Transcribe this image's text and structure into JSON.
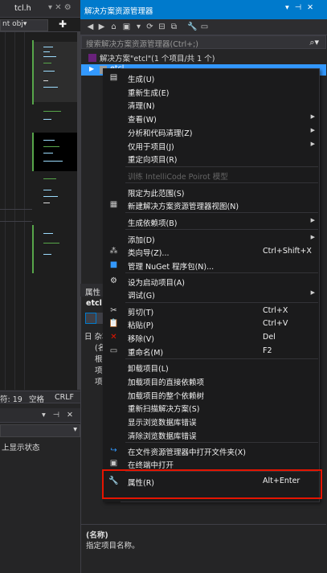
{
  "editor": {
    "tab_name": "tcl.h",
    "tab_controls": "▾ ✕ ⚙",
    "nav_combo": "nt obj▾",
    "nav_plus": "✚",
    "status": {
      "col": "符: 19",
      "spaces": "空格",
      "eol": "CRLF"
    }
  },
  "output": {
    "title_controls": "▾ ⊣ ✕",
    "combo_arrow": "▾",
    "text": "上显示状态"
  },
  "solution_explorer": {
    "title": "解决方案资源管理器",
    "title_controls": [
      "▾",
      "⊣",
      "✕"
    ],
    "search_placeholder": "搜索解决方案资源管理器(Ctrl+;)",
    "solution_label": "解决方案\"etcl\"(1 个项目/共 1 个)",
    "project_label": "etcl"
  },
  "properties": {
    "title": "属性",
    "object_name": "etcl",
    "group_label": "日 杂项",
    "rows": [
      "(名称",
      "根命",
      "项目",
      "项目"
    ],
    "desc_name": "(名称)",
    "desc_text": "指定项目名称。"
  },
  "context_menu": {
    "items": [
      {
        "icon": "build-icon",
        "label": "生成(U)"
      },
      {
        "label": "重新生成(E)"
      },
      {
        "label": "清理(N)"
      },
      {
        "label": "查看(W)",
        "submenu": true
      },
      {
        "label": "分析和代码清理(Z)",
        "submenu": true
      },
      {
        "label": "仅用于项目(J)",
        "submenu": true
      },
      {
        "label": "重定向项目(R)"
      },
      {
        "label": "训练 IntelliCode Poirot 模型",
        "disabled": true
      },
      {
        "label": "限定为此范围(S)"
      },
      {
        "icon": "new-view-icon",
        "label": "新建解决方案资源管理器视图(N)"
      },
      {
        "label": "生成依赖项(B)",
        "submenu": true
      },
      {
        "label": "添加(D)",
        "submenu": true
      },
      {
        "icon": "class-wizard-icon",
        "label": "类向导(Z)...",
        "shortcut": "Ctrl+Shift+X"
      },
      {
        "icon": "nuget-icon",
        "label": "管理 NuGet 程序包(N)..."
      },
      {
        "icon": "settings-icon",
        "label": "设为启动项目(A)"
      },
      {
        "label": "调试(G)",
        "submenu": true
      },
      {
        "icon": "cut-icon",
        "label": "剪切(T)",
        "shortcut": "Ctrl+X"
      },
      {
        "icon": "paste-icon",
        "label": "粘贴(P)",
        "shortcut": "Ctrl+V"
      },
      {
        "icon": "remove-icon",
        "label": "移除(V)",
        "shortcut": "Del"
      },
      {
        "icon": "rename-icon",
        "label": "重命名(M)",
        "shortcut": "F2"
      },
      {
        "label": "卸载项目(L)"
      },
      {
        "label": "加载项目的直接依赖项"
      },
      {
        "label": "加载项目的整个依赖树"
      },
      {
        "label": "重新扫描解决方案(S)"
      },
      {
        "label": "显示浏览数据库错误"
      },
      {
        "label": "清除浏览数据库错误"
      },
      {
        "icon": "open-folder-icon",
        "label": "在文件资源管理器中打开文件夹(X)"
      },
      {
        "icon": "terminal-icon",
        "label": "在终端中打开"
      },
      {
        "icon": "wrench-icon",
        "label": "属性(R)",
        "shortcut": "Alt+Enter"
      }
    ]
  }
}
